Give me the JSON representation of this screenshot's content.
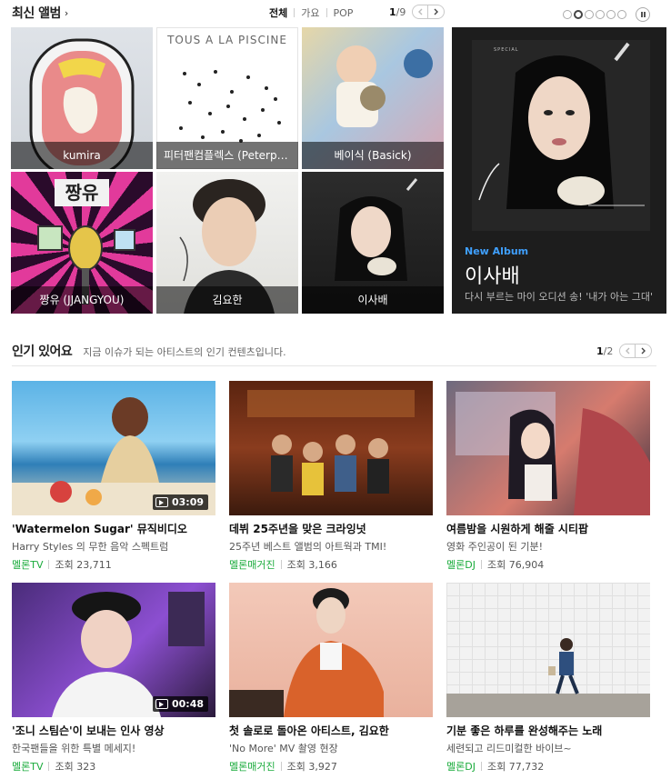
{
  "latest": {
    "title": "최신 앨범",
    "arrow": "›",
    "filters": [
      "전체",
      "가요",
      "POP"
    ],
    "page_current": "1",
    "page_total": "/9",
    "albums": [
      {
        "name": "kumira"
      },
      {
        "name": "피터팬컴플렉스 (Peterpan Complex)",
        "cover_text": "TOUS A LA PISCINE"
      },
      {
        "name": "베이식 (Basick)"
      },
      {
        "name": "짱유 (JJANGYOU)",
        "cover_text": "짱유"
      },
      {
        "name": "김요한"
      },
      {
        "name": "이사배"
      }
    ]
  },
  "feature": {
    "label": "New Album",
    "artist": "이사배",
    "desc": "다시 부르는 마이 오디션 송! '내가 아는 그대'",
    "cover_tag": "SPECIAL"
  },
  "popular": {
    "title": "인기 있어요",
    "subtitle": "지금 이슈가 되는 아티스트의 인기 컨텐츠입니다.",
    "page_current": "1",
    "page_total": "/2",
    "views_label": "조회",
    "items": [
      {
        "title": "'Watermelon Sugar' 뮤직비디오",
        "sub": "Harry Styles 의 무한 음악 스펙트럼",
        "source": "멜론TV",
        "views": "23,711",
        "duration": "03:09"
      },
      {
        "title": "데뷔 25주년을 맞은 크라잉넛",
        "sub": "25주년 베스트 앨범의 아트웍과 TMI!",
        "source": "멜론매거진",
        "views": "3,166"
      },
      {
        "title": "여름밤을 시원하게 해줄 시티팝",
        "sub": "영화 주인공이 된 기분!",
        "source": "멜론DJ",
        "views": "76,904"
      },
      {
        "title": "'조니 스팀슨'이 보내는 인사 영상",
        "sub": "한국팬들을 위한 특별 메세지!",
        "source": "멜론TV",
        "views": "323",
        "duration": "00:48"
      },
      {
        "title": "첫 솔로로 돌아온 아티스트, 김요한",
        "sub": "'No More' MV 촬영 현장",
        "source": "멜론매거진",
        "views": "3,927"
      },
      {
        "title": "기분 좋은 하루를 완성해주는 노래",
        "sub": "세련되고 리드미컬한 바이브~",
        "source": "멜론DJ",
        "views": "77,732"
      }
    ]
  }
}
